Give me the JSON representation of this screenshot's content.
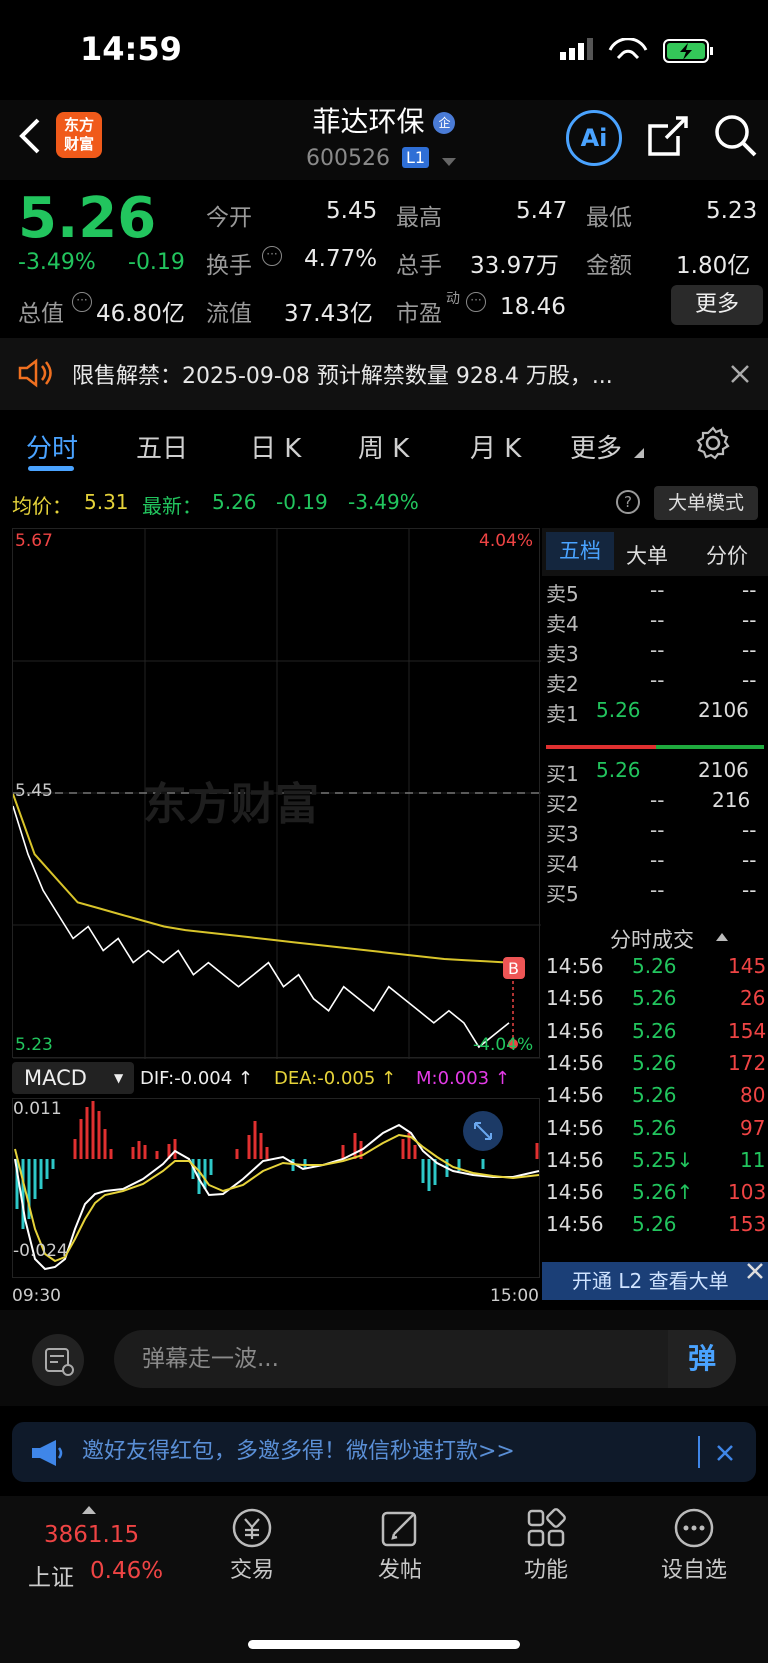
{
  "status": {
    "time": "14:59"
  },
  "header": {
    "logo_text": "东方\n财富",
    "title": "菲达环保",
    "title_badge": "企",
    "code": "600526",
    "level": "L1",
    "ai_label": "Ai"
  },
  "quote": {
    "price": "5.26",
    "change_pct": "-3.49%",
    "change": "-0.19",
    "open_label": "今开",
    "open": "5.45",
    "high_label": "最高",
    "high": "5.47",
    "low_label": "最低",
    "low": "5.23",
    "turnover_label": "换手",
    "turnover": "4.77%",
    "volume_label": "总手",
    "volume": "33.97万",
    "amount_label": "金额",
    "amount": "1.80亿",
    "mktcap_label": "总值",
    "mktcap": "46.80亿",
    "float_label": "流值",
    "float": "37.43亿",
    "pe_label": "市盈",
    "pe_sup": "动",
    "pe": "18.46",
    "more_label": "更多"
  },
  "notice": {
    "text": "限售解禁：2025-09-08 预计解禁数量 928.4 万股，..."
  },
  "tabs": [
    "分时",
    "五日",
    "日 K",
    "周 K",
    "月 K",
    "更多"
  ],
  "active_tab": 0,
  "infobar": {
    "avg_label": "均价：",
    "avg": "5.31",
    "latest_label": "最新：",
    "latest": "5.26",
    "chg": "-0.19",
    "chg_pct": "-3.49%",
    "mode_label": "大单模式"
  },
  "chart": {
    "top_price": "5.67",
    "top_pct": "4.04%",
    "ref_price": "5.45",
    "bottom_price": "5.23",
    "bottom_pct": "-4.04%",
    "watermark": "东方财富",
    "marker": "B",
    "macd_label": "MACD",
    "dif": "DIF:-0.004 ↑",
    "dea": "DEA:-0.005 ↑",
    "m": "M:0.003 ↑",
    "macd_top": "0.011",
    "macd_bottom": "-0.024",
    "time_start": "09:30",
    "time_end": "15:00"
  },
  "chart_data": {
    "type": "line",
    "ylim": [
      5.23,
      5.67
    ],
    "series": [
      {
        "values": [
          5.44,
          5.4,
          5.37,
          5.35,
          5.33,
          5.34,
          5.32,
          5.33,
          5.31,
          5.32,
          5.31,
          5.32,
          5.3,
          5.31,
          5.3,
          5.29,
          5.3,
          5.31,
          5.29,
          5.3,
          5.28,
          5.27,
          5.29,
          5.28,
          5.27,
          5.29,
          5.28,
          5.27,
          5.26,
          5.27,
          5.26,
          5.24,
          5.25,
          5.26
        ]
      },
      {
        "values": [
          5.45,
          5.4,
          5.38,
          5.36,
          5.355,
          5.35,
          5.345,
          5.34,
          5.337,
          5.335,
          5.333,
          5.331,
          5.329,
          5.327,
          5.325,
          5.323,
          5.321,
          5.319,
          5.317,
          5.315,
          5.313,
          5.312,
          5.311,
          5.31
        ]
      }
    ]
  },
  "orderbook": {
    "tabs": [
      "五档",
      "大单",
      "分价"
    ],
    "asks": [
      {
        "label": "卖5",
        "price": "--",
        "vol": "--"
      },
      {
        "label": "卖4",
        "price": "--",
        "vol": "--"
      },
      {
        "label": "卖3",
        "price": "--",
        "vol": "--"
      },
      {
        "label": "卖2",
        "price": "--",
        "vol": "--"
      },
      {
        "label": "卖1",
        "price": "5.26",
        "vol": "2106"
      }
    ],
    "bids": [
      {
        "label": "买1",
        "price": "5.26",
        "vol": "2106"
      },
      {
        "label": "买2",
        "price": "--",
        "vol": "216"
      },
      {
        "label": "买3",
        "price": "--",
        "vol": "--"
      },
      {
        "label": "买4",
        "price": "--",
        "vol": "--"
      },
      {
        "label": "买5",
        "price": "--",
        "vol": "--"
      }
    ],
    "ticks_title": "分时成交",
    "ticks": [
      {
        "t": "14:56",
        "p": "5.26",
        "v": "145"
      },
      {
        "t": "14:56",
        "p": "5.26",
        "v": "26"
      },
      {
        "t": "14:56",
        "p": "5.26",
        "v": "154"
      },
      {
        "t": "14:56",
        "p": "5.26",
        "v": "172"
      },
      {
        "t": "14:56",
        "p": "5.26",
        "v": "80"
      },
      {
        "t": "14:56",
        "p": "5.26",
        "v": "97"
      },
      {
        "t": "14:56",
        "p": "5.25↓",
        "v": "11"
      },
      {
        "t": "14:56",
        "p": "5.26↑",
        "v": "103"
      },
      {
        "t": "14:56",
        "p": "5.26",
        "v": "153"
      }
    ],
    "l2_label": "开通 L2 查看大单"
  },
  "comment": {
    "placeholder": "弹幕走一波...",
    "send_icon_label": "弹"
  },
  "invite": {
    "text": "邀好友得红包，多邀多得！微信秒速打款>>"
  },
  "bottom_nav": {
    "index_value": "3861.15",
    "index_name": "上证",
    "index_pct": "0.46%",
    "items": [
      "交易",
      "发帖",
      "功能",
      "设自选"
    ]
  }
}
